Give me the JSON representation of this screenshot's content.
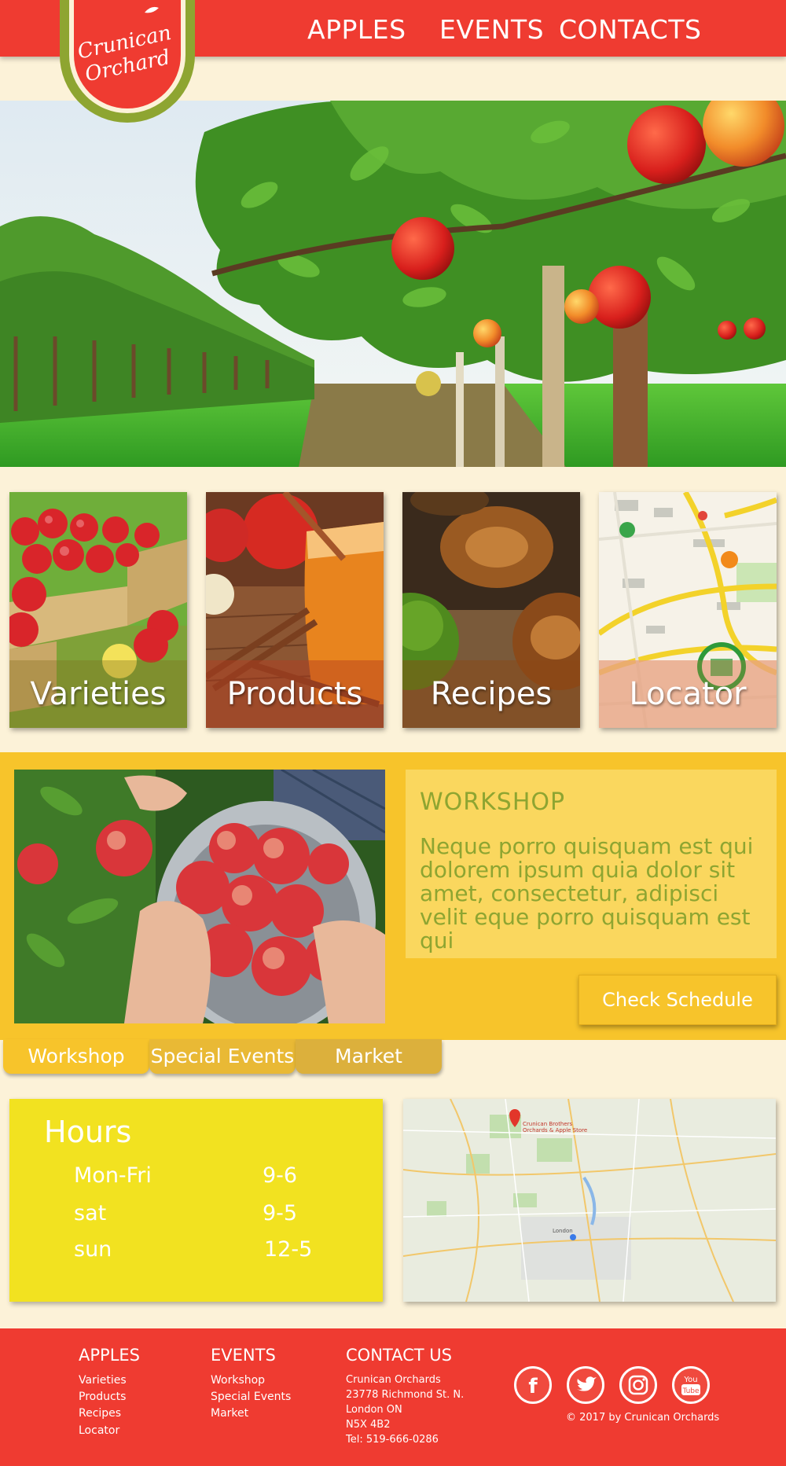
{
  "logo": {
    "line1": "Crunican",
    "line2": "Orchard"
  },
  "nav": {
    "apples": "APPLES",
    "events": "EVENTS",
    "contacts": "CONTACTS"
  },
  "tiles": [
    {
      "label": "Varieties"
    },
    {
      "label": "Products"
    },
    {
      "label": "Recipes"
    },
    {
      "label": "Locator"
    }
  ],
  "workshop": {
    "title": "WORKSHOP",
    "body": "Neque porro quisquam est qui dolorem ipsum quia dolor sit amet, consectetur, adipisci velit eque porro quisquam est qui",
    "button": "Check Schedule",
    "tabs": [
      "Workshop",
      "Special Events",
      "Market"
    ]
  },
  "hours": {
    "title": "Hours",
    "rows": [
      {
        "day": "Mon-Fri",
        "time": "9-6"
      },
      {
        "day": "sat",
        "time": "9-5"
      },
      {
        "day": "sun",
        "time": "12-5"
      }
    ]
  },
  "map": {
    "pin_label_1": "Crunican Brothers",
    "pin_label_2": "Orchards & Apple Store",
    "city": "London"
  },
  "footer": {
    "apples": {
      "heading": "APPLES",
      "links": [
        "Varieties",
        "Products",
        "Recipes",
        "Locator"
      ]
    },
    "events": {
      "heading": "EVENTS",
      "links": [
        "Workshop",
        "Special Events",
        "Market"
      ]
    },
    "contact": {
      "heading": "CONTACT US",
      "lines": [
        "Crunican Orchards",
        "23778 Richmond St. N.",
        "London ON",
        "N5X 4B2",
        "Tel: 519-666-0286"
      ]
    },
    "social": [
      "facebook-icon",
      "twitter-icon",
      "instagram-icon",
      "youtube-icon"
    ],
    "copyright": "© 2017 by Crunican Orchards"
  },
  "colors": {
    "brand_red": "#ef3b31",
    "cream": "#fcf2d8",
    "gold": "#f7c42b",
    "olive": "#8ea531",
    "yellow": "#f2e220"
  }
}
